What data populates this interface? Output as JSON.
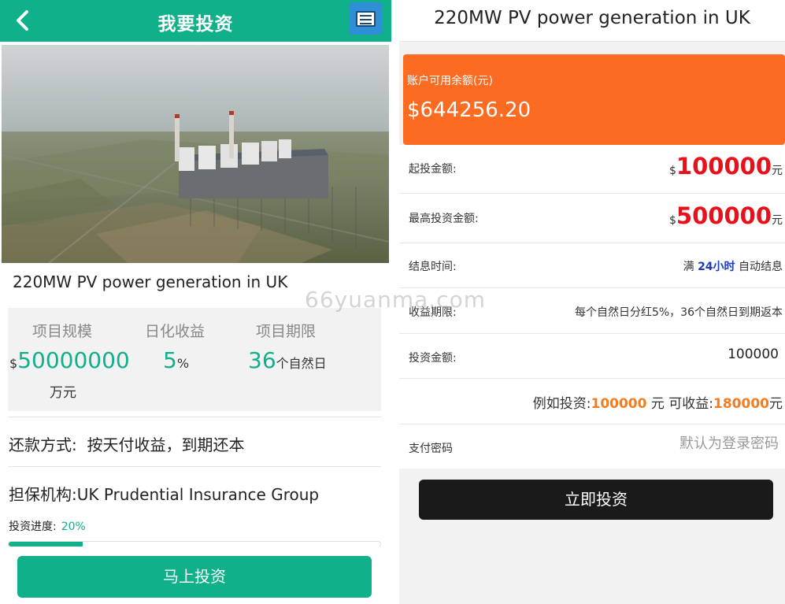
{
  "left": {
    "header": {
      "title": "我要投资"
    },
    "project_title": "220MW PV power generation in UK",
    "stats": {
      "scale": {
        "label": "项目规模",
        "currency": "$",
        "value": "50000000",
        "unit": "万元"
      },
      "daily_return": {
        "label": "日化收益",
        "value": "5",
        "unit": "%"
      },
      "term": {
        "label": "项目期限",
        "value": "36",
        "unit": "个自然日"
      }
    },
    "repayment": {
      "label": "还款方式:",
      "value": "按天付收益，到期还本"
    },
    "guarantor": {
      "label": "担保机构:",
      "value": "UK Prudential Insurance Group"
    },
    "progress": {
      "label": "投资进度:",
      "value_text": "20%",
      "value": 0.2
    },
    "invest_button": "马上投资"
  },
  "right": {
    "header": {
      "title": "220MW PV power generation in UK"
    },
    "balance": {
      "label": "账户可用余额(元)",
      "value": "$644256.20"
    },
    "min_invest": {
      "label": "起投金额:",
      "currency": "$",
      "value": "100000",
      "unit": "元"
    },
    "max_invest": {
      "label": "最高投资金额:",
      "currency": "$",
      "value": "500000",
      "unit": "元"
    },
    "settlement": {
      "label": "结息时间:",
      "prefix": "满",
      "value": "24小时",
      "suffix": "自动结息"
    },
    "income_term": {
      "label": "收益期限:",
      "value": "每个自然日分红5%，36个自然日到期返本"
    },
    "invest_amount": {
      "label": "投资金额:",
      "value": "100000"
    },
    "example": {
      "prefix": "例如投资:",
      "amount": "100000",
      "middle": "元 可收益:",
      "income": "180000",
      "suffix": "元"
    },
    "pay_password": {
      "label": "支付密码",
      "placeholder": "默认为登录密码"
    },
    "confirm_button": "立即投资"
  },
  "watermark": "66yuanma.com",
  "colors": {
    "brand_green": "#10b08a",
    "balance_orange": "#fb6b21",
    "amount_red": "#e8101a",
    "accent_orange": "#f57c1e",
    "accent_blue": "#1b3cc0"
  },
  "icons": [
    "back-arrow-icon",
    "app-logo-icon"
  ]
}
